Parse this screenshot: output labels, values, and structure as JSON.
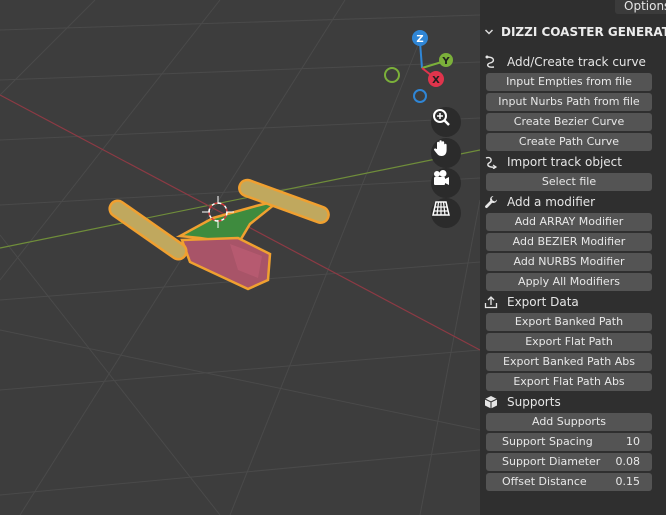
{
  "header": {
    "options_tab": "Options"
  },
  "gizmo": {
    "z": "Z",
    "y": "Y",
    "x": "X"
  },
  "panel": {
    "title": "DIZZI COASTER GENERATOR",
    "sections": {
      "add_create": {
        "label": "Add/Create track curve",
        "buttons": [
          "Input Empties from file",
          "Input Nurbs Path from file",
          "Create Bezier Curve",
          "Create Path Curve"
        ]
      },
      "import": {
        "label": "Import track object",
        "buttons": [
          "Select file"
        ]
      },
      "modifier": {
        "label": "Add a modifier",
        "buttons": [
          "Add ARRAY Modifier",
          "Add BEZIER Modifier",
          "Add NURBS Modifier",
          "Apply All Modifiers"
        ]
      },
      "export": {
        "label": "Export Data",
        "buttons": [
          "Export Banked Path",
          "Export Flat Path",
          "Export Banked Path Abs",
          "Export Flat Path Abs"
        ]
      },
      "supports": {
        "label": "Supports",
        "buttons": [
          "Add Supports"
        ],
        "fields": [
          {
            "label": "Support Spacing",
            "value": "10"
          },
          {
            "label": "Support Diameter",
            "value": "0.08"
          },
          {
            "label": "Offset Distance",
            "value": "0.15"
          }
        ]
      }
    }
  },
  "icons": {
    "collapse": "chevron-down-icon",
    "add_create": "curve-icon",
    "import": "import-curve-icon",
    "modifier": "wrench-icon",
    "export": "export-icon",
    "supports": "cube-icon",
    "nav": [
      "zoom-icon",
      "hand-pan-icon",
      "camera-icon",
      "grid-icon"
    ]
  },
  "colors": {
    "viewport_bg": "#3d3d3d",
    "panel_bg": "#2f2f2f",
    "button_bg": "#545454",
    "axis_x": "#e0344c",
    "axis_y": "#7bb03a",
    "axis_z": "#2f86d6",
    "selection_outline": "#f0a030"
  }
}
